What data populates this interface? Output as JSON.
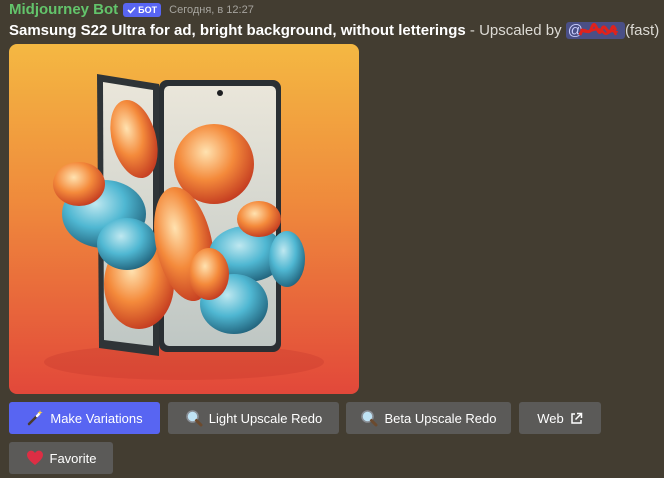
{
  "message": {
    "author": "Midjourney Bot",
    "badge": "БОТ",
    "timestamp": "Сегодня, в 12:27",
    "prompt": "Samsung S22 Ultra for ad, bright background, without letterings",
    "separator": " - ",
    "upscaled_text": "Upscaled by ",
    "mention": "@",
    "speed": "(fast)"
  },
  "buttons": {
    "make_variations": "Make Variations",
    "light_upscale_redo": "Light Upscale Redo",
    "beta_upscale_redo": "Beta Upscale Redo",
    "web": "Web",
    "favorite": "Favorite"
  },
  "icons": {
    "make_variations": "magic-wand-icon",
    "light_upscale_redo": "magnifier-icon",
    "beta_upscale_redo": "magnifier-icon",
    "web": "external-link-icon",
    "favorite": "red-heart-icon",
    "badge": "checkmark-icon"
  },
  "colors": {
    "background": "#433d31",
    "username": "#63c46b",
    "primary_button": "#5865f2",
    "secondary_button": "#5b5a58"
  }
}
